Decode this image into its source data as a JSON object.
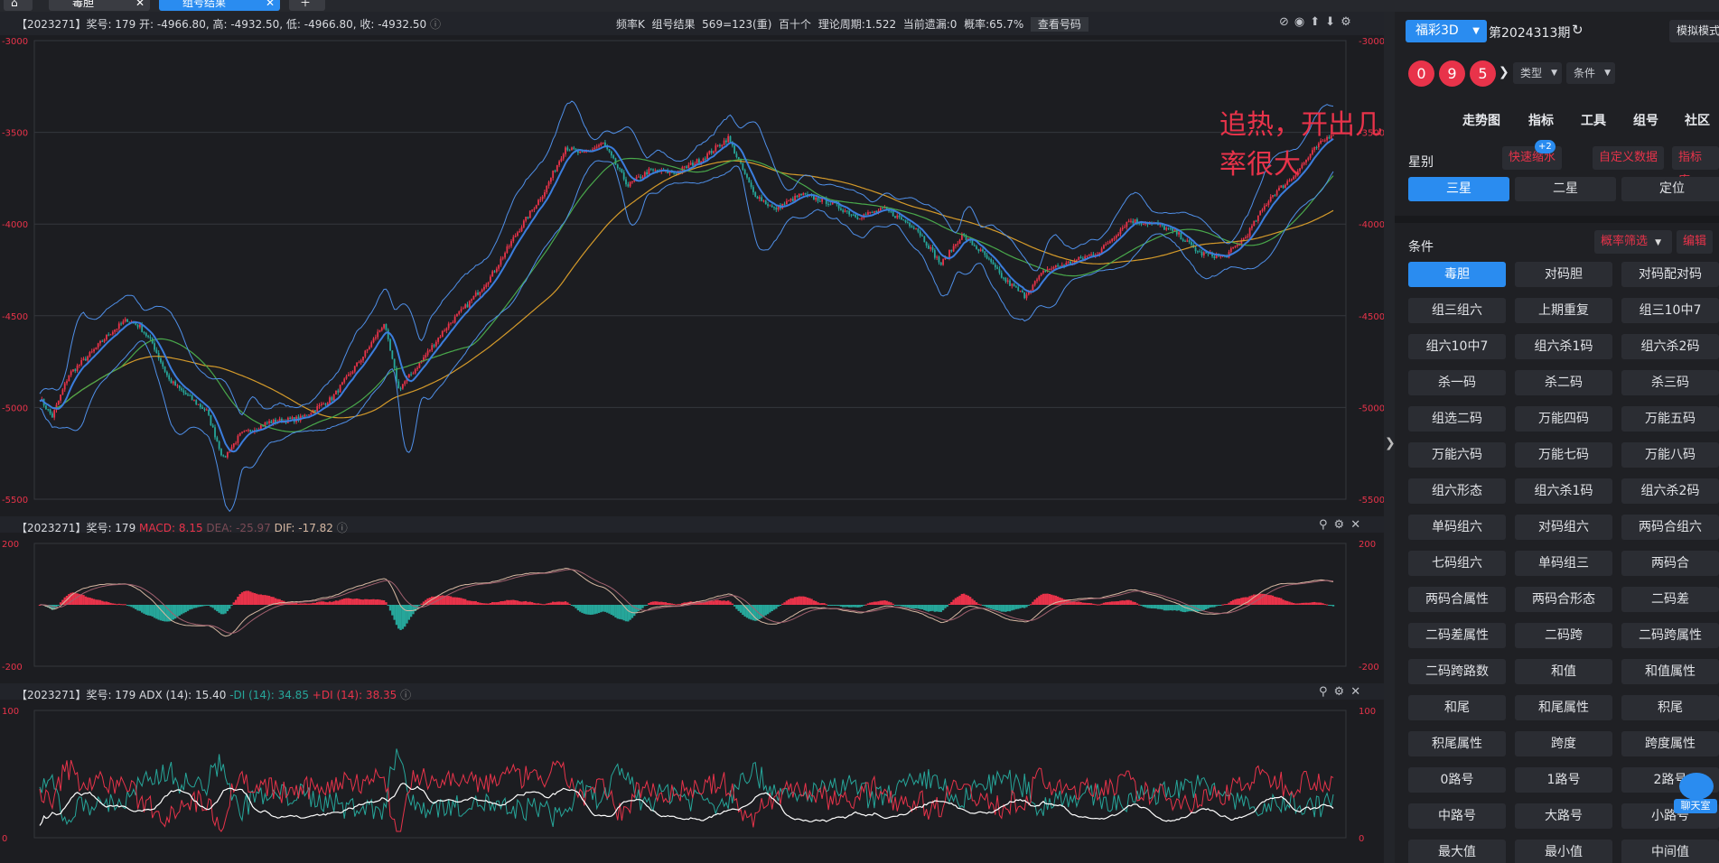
{
  "tabs": [
    {
      "label": "毒胆"
    },
    {
      "label": "组号结果"
    }
  ],
  "main_header": {
    "info": "【2023271】奖号: 179  开: -4966.80, 高: -4932.50, 低: -4966.80, 收: -4932.50",
    "freq": "频率K",
    "group": "组号结果",
    "ratio": "569=123(重)",
    "pos": "百十个",
    "period": "理论周期:1.522",
    "miss": "当前遗漏:0",
    "prob": "概率:65.7%",
    "query_btn": "查看号码"
  },
  "annotation": "追热，开出几率很大",
  "macd_header": {
    "prefix": "【2023271】奖号: 179",
    "macd": "MACD: 8.15",
    "dea": "DEA: -25.97",
    "dif": "DIF: -17.82"
  },
  "adx_header": {
    "prefix": "【2023271】奖号: 179 ADX (14): 15.40",
    "mdi": "-DI (14): 34.85",
    "pdi": "+DI (14): 38.35"
  },
  "sidebar": {
    "lottery": "福彩3D",
    "issue": "第2024313期",
    "mode_btn": "模拟模式",
    "balls": [
      "0",
      "9",
      "5"
    ],
    "type_label": "类型",
    "cond_label": "条件",
    "nav": [
      "走势图",
      "指标",
      "工具",
      "组号",
      "社区"
    ],
    "star_label": "星别",
    "quick_label": "快速缩水",
    "badge": "+2",
    "custom_label": "自定义数据",
    "lib_label": "指标库",
    "star_tabs": [
      "三星",
      "二星",
      "定位"
    ],
    "cond_title": "条件",
    "prob_filter": "概率筛选",
    "edit": "编辑",
    "buttons": [
      "毒胆",
      "对码胆",
      "对码配对码",
      "组三组六",
      "上期重复",
      "组三10中7",
      "组六10中7",
      "组六杀1码",
      "组六杀2码",
      "杀一码",
      "杀二码",
      "杀三码",
      "组选二码",
      "万能四码",
      "万能五码",
      "万能六码",
      "万能七码",
      "万能八码",
      "组六形态",
      "组六杀1码",
      "组六杀2码",
      "单码组六",
      "对码组六",
      "两码合组六",
      "七码组六",
      "单码组三",
      "两码合",
      "两码合属性",
      "两码合形态",
      "二码差",
      "二码差属性",
      "二码跨",
      "二码跨属性",
      "二码跨路数",
      "和值",
      "和值属性",
      "和尾",
      "和尾属性",
      "积尾",
      "积尾属性",
      "跨度",
      "跨度属性",
      "0路号",
      "1路号",
      "2路号",
      "中路号",
      "大路号",
      "小路号",
      "最大值",
      "最小值",
      "中间值"
    ],
    "chat_label": "聊天室"
  },
  "chart_data": [
    {
      "type": "candlestick",
      "title": "组号结果",
      "y_ticks": [
        -3000,
        -3500,
        -4000,
        -4500,
        -5000,
        -5500
      ],
      "ylim": [
        -5500,
        -3000
      ],
      "n_bars": 179,
      "key_points": [
        [
          0,
          -4950
        ],
        [
          6,
          -5050
        ],
        [
          14,
          -4820
        ],
        [
          25,
          -4700
        ],
        [
          33,
          -4600
        ],
        [
          42,
          -4520
        ],
        [
          48,
          -4560
        ],
        [
          54,
          -4650
        ],
        [
          62,
          -4850
        ],
        [
          70,
          -4930
        ],
        [
          80,
          -5020
        ],
        [
          88,
          -5280
        ],
        [
          96,
          -5150
        ],
        [
          110,
          -5080
        ],
        [
          125,
          -5060
        ],
        [
          140,
          -4950
        ],
        [
          155,
          -4720
        ],
        [
          165,
          -4540
        ],
        [
          172,
          -4900
        ],
        [
          180,
          -4790
        ],
        [
          195,
          -4560
        ],
        [
          205,
          -4440
        ],
        [
          216,
          -4290
        ],
        [
          228,
          -4060
        ],
        [
          242,
          -3820
        ],
        [
          252,
          -3580
        ],
        [
          260,
          -3620
        ],
        [
          270,
          -3560
        ],
        [
          282,
          -3790
        ],
        [
          292,
          -3710
        ],
        [
          305,
          -3720
        ],
        [
          318,
          -3640
        ],
        [
          330,
          -3530
        ],
        [
          342,
          -3830
        ],
        [
          352,
          -3920
        ],
        [
          365,
          -3840
        ],
        [
          378,
          -3880
        ],
        [
          392,
          -3960
        ],
        [
          405,
          -3920
        ],
        [
          420,
          -4020
        ],
        [
          432,
          -4220
        ],
        [
          442,
          -4060
        ],
        [
          452,
          -4160
        ],
        [
          462,
          -4300
        ],
        [
          472,
          -4390
        ],
        [
          482,
          -4250
        ],
        [
          494,
          -4210
        ],
        [
          508,
          -4150
        ],
        [
          522,
          -3980
        ],
        [
          535,
          -4000
        ],
        [
          545,
          -4050
        ],
        [
          556,
          -4160
        ],
        [
          568,
          -4180
        ],
        [
          578,
          -4070
        ],
        [
          590,
          -3850
        ],
        [
          600,
          -3750
        ],
        [
          612,
          -3580
        ],
        [
          620,
          -3500
        ]
      ],
      "last_ohlc": {
        "open": -4966.8,
        "high": -4932.5,
        "low": -4966.8,
        "close": -4932.5
      }
    },
    {
      "type": "macd",
      "y_ticks": [
        200,
        -200
      ],
      "ylim": [
        -200,
        200
      ],
      "macd": 8.15,
      "dea": -25.97,
      "dif": -17.82
    },
    {
      "type": "adx",
      "y_ticks": [
        100,
        0
      ],
      "ylim": [
        0,
        100
      ],
      "adx": 15.4,
      "minus_di": 34.85,
      "plus_di": 38.35
    }
  ],
  "colors": {
    "up": "#e8334a",
    "down": "#26a69a",
    "accent": "#2a8cf0",
    "ma_fast": "#3b7ddd",
    "ma_mid": "#49a84b",
    "ma_slow": "#d49a2a",
    "boll": "#4f8fe8"
  }
}
